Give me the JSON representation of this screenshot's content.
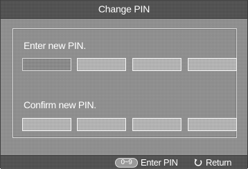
{
  "dialog": {
    "title": "Change PIN"
  },
  "new_pin": {
    "label": "Enter new PIN.",
    "digits": [
      "",
      "",
      "",
      ""
    ],
    "active_index": 0
  },
  "confirm_pin": {
    "label": "Confirm new PIN.",
    "digits": [
      "",
      "",
      "",
      ""
    ]
  },
  "footer": {
    "key_badge": "0~9",
    "enter_hint": "Enter PIN",
    "return_icon": "return-arrow-icon",
    "return_hint": "Return"
  }
}
